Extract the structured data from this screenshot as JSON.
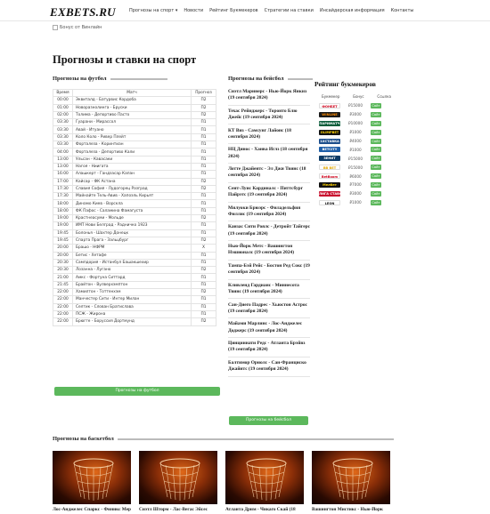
{
  "header": {
    "logo": "EXBETS.RU",
    "menu": [
      "Прогнозы на спорт ▾",
      "Новости",
      "Рейтинг Букмекеров",
      "Стратегии на ставки",
      "Инсайдерская информация",
      "Контакты"
    ]
  },
  "banner_alt": "Бонус от Винлайн",
  "page_title": "Прогнозы и ставки на спорт",
  "football": {
    "title": "Прогнозы на футбол",
    "columns": [
      "Время",
      "Матч",
      "Прогноз"
    ],
    "rows": [
      [
        "00:00",
        "Эквиталд - Батурвис Кордоба",
        "П2"
      ],
      [
        "01:00",
        "Новоразнолинга - Бруски",
        "П2"
      ],
      [
        "02:00",
        "Толима - Депортиво Пасто",
        "П2"
      ],
      [
        "03:30",
        "Гуарани - Мирассол",
        "П1"
      ],
      [
        "03:30",
        "Авай - Итуано",
        "П1"
      ],
      [
        "03:30",
        "Коло Коло - Ривер Плейт",
        "П1"
      ],
      [
        "03:30",
        "Форталеза - Коринтиан",
        "П1"
      ],
      [
        "04:00",
        "Форталеза - Депортиво Кали",
        "П1"
      ],
      [
        "13:00",
        "Ульсан - Кавасаки",
        "П1"
      ],
      [
        "13:00",
        "Нагоя - Ниигата",
        "П1"
      ],
      [
        "16:00",
        "Алашкерт - Гандзасар Капан",
        "П1"
      ],
      [
        "17:00",
        "Кайсар - ФК Астана",
        "П2"
      ],
      [
        "17:30",
        "Славия София - Лудогорец Разград",
        "П2"
      ],
      [
        "17:30",
        "Майнайте Тель-Авив - Хапоэль Кирьят",
        "П1"
      ],
      [
        "18:00",
        "Динамо Киев - Ворскла",
        "П1"
      ],
      [
        "18:00",
        "ФК Пафос - Саламина Фамагуста",
        "П1"
      ],
      [
        "19:00",
        "Крастнеасуми - Мольде",
        "П2"
      ],
      [
        "19:00",
        "ИМТ Нови Белград - Радничко 1923",
        "П1"
      ],
      [
        "19:45",
        "Болонья - Шахтер Донецк",
        "П1"
      ],
      [
        "19:45",
        "Спарта Прага - Зальцбург",
        "П2"
      ],
      [
        "20:00",
        "Брашо - НФРМ",
        "Х"
      ],
      [
        "20:00",
        "Бетис - Хетафе",
        "П1"
      ],
      [
        "20:30",
        "Сампдория - Истанбул Башакшехир",
        "П1"
      ],
      [
        "20:30",
        "Лозанна - Лугано",
        "П2"
      ],
      [
        "21:00",
        "Амкс - Фортуна Ситтард",
        "П1"
      ],
      [
        "21:45",
        "Брайтон - Вулверхэмптон",
        "П1"
      ],
      [
        "22:00",
        "Хамилтон - Тоттенхэм",
        "П2"
      ],
      [
        "22:00",
        "Манчестер Сити - Интер Милан",
        "П1"
      ],
      [
        "22:00",
        "Селтик - Слован Братислава",
        "П1"
      ],
      [
        "22:00",
        "ПСЖ - Жирона",
        "П1"
      ],
      [
        "22:00",
        "Брюгге - Боруссия Дортмунд",
        "П2"
      ]
    ],
    "button": "Прогнозы на футбол"
  },
  "baseball": {
    "title": "Прогнозы на бейсбол",
    "items": [
      "Сиэтл Маринерс - Нью-Йорк Янкиз (19 сентября 2024)",
      "Техас Рейнджерс - Торонто Блю Джейс (19 сентября 2024)",
      "КТ Виз - Самсунг Лайонс (18 сентября 2024)",
      "НЦ Динос - Ханва Иглз (18 сентября 2024)",
      "Лотте Джайентс - Эл Джи Твинс (18 сентября 2024)",
      "Сент-Луис Кардиналс - Питтсбург Пайрэтс (19 сентября 2024)",
      "Милуоки Брюэрс - Филадельфия Филлис (19 сентября 2024)",
      "Канзас Сити Роялс - Детройт Тайгерс (19 сентября 2024)",
      "Нью-Йорк Метс - Вашингтон Нэшионалс (19 сентября 2024)",
      "Тампа-Бэй Рейс - Бостон Ред Сокс (19 сентября 2024)",
      "Кливленд Гардианс - Миннесота Твинс (19 сентября 2024)",
      "Сан-Диего Падрес - Хьюстон Астрос (19 сентября 2024)",
      "Майами Марлинс - Лос-Анджелес Доджерс (19 сентября 2024)",
      "Цинциннати Редс - Атланта Брэйвз (19 сентября 2024)",
      "Балтимор Ориолс - Сан-Франциско Джайнтс (19 сентября 2024)"
    ],
    "button": "Прогнозы на бейсбол"
  },
  "rating": {
    "title": "Рейтинг букмекеров",
    "columns": [
      "Букмекер",
      "Бонус",
      "Ссылка"
    ],
    "rows": [
      {
        "name": "ФОНБЕТ",
        "bonus": "₽15000",
        "bg": "#ffffff",
        "fg": "#d0021b"
      },
      {
        "name": "WINLINE",
        "bonus": "₽3000",
        "bg": "#1a1a1a",
        "fg": "#ff8a00"
      },
      {
        "name": "ПАРИМАТЧ",
        "bonus": "₽10000",
        "bg": "#0b5d3b",
        "fg": "#ffffff"
      },
      {
        "name": "OLIMPBET",
        "bonus": "₽1000",
        "bg": "#111111",
        "fg": "#ffd200"
      },
      {
        "name": "1XСТАВКА",
        "bonus": "₽4000",
        "bg": "#1d4f8c",
        "fg": "#ffffff"
      },
      {
        "name": "BETCITY",
        "bonus": "₽1000",
        "bg": "#1f5fa8",
        "fg": "#ffffff"
      },
      {
        "name": "ЗЕНИТ",
        "bonus": "₽15000",
        "bg": "#0d3b66",
        "fg": "#ffffff"
      },
      {
        "name": "BB BET",
        "bonus": "₽15000",
        "bg": "#ffffff",
        "fg": "#e3a800"
      },
      {
        "name": "BetBoom",
        "bonus": "₽6000",
        "bg": "#ffffff",
        "fg": "#d0021b"
      },
      {
        "name": "Мелбет",
        "bonus": "₽7000",
        "bg": "#111111",
        "fg": "#ffd200"
      },
      {
        "name": "ЛИГА СТАВОК",
        "bonus": "₽3000",
        "bg": "#c8102e",
        "fg": "#ffffff"
      },
      {
        "name": "LEON",
        "bonus": "₽1000",
        "bg": "#ffffff",
        "fg": "#111111"
      }
    ],
    "go_label": "Сайт",
    "colors": {
      "go_button": "#5cb85c"
    }
  },
  "basketball": {
    "title": "Прогнозы на баскетбол",
    "cards": [
      "Лос-Анджелес Спаркс - Финикс Меркьюри",
      "Сиэтл Шторм - Лас-Вегас Эйсес",
      "Атланта Дрим - Чикаго Скай (18",
      "Вашингтон Мистикс - Нью-Йорк"
    ]
  }
}
